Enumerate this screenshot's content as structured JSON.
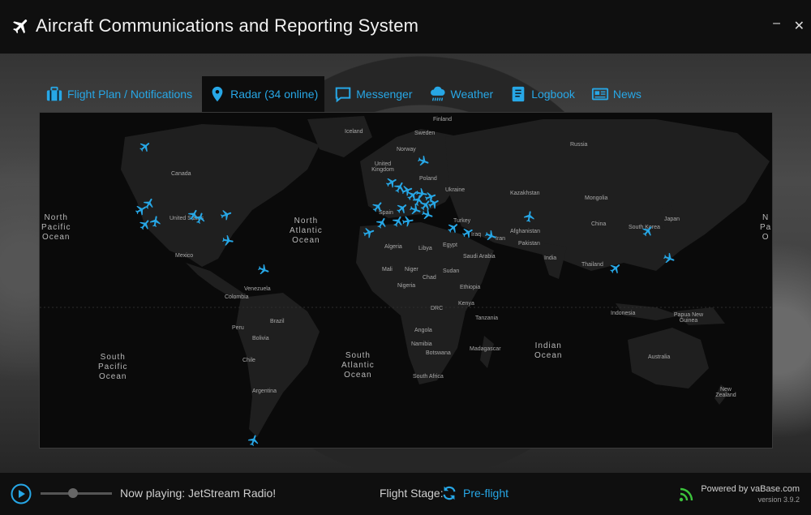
{
  "app": {
    "title": "Aircraft Communications and Reporting System",
    "window_controls": [
      "minimize",
      "close"
    ],
    "minimize_glyph": "–",
    "close_glyph": "✕"
  },
  "tabs": [
    {
      "label": "Flight Plan / Notifications",
      "icon": "briefcase-icon",
      "active": false
    },
    {
      "label": "Radar (34 online)",
      "icon": "map-pin-icon",
      "active": true
    },
    {
      "label": "Messenger",
      "icon": "chat-icon",
      "active": false
    },
    {
      "label": "Weather",
      "icon": "cloud-rain-icon",
      "active": false
    },
    {
      "label": "Logbook",
      "icon": "book-icon",
      "active": false
    },
    {
      "label": "News",
      "icon": "newspaper-icon",
      "active": false
    }
  ],
  "map": {
    "oceans": [
      "North\nPacific\nOcean",
      "North\nAtlantic\nOcean",
      "South\nPacific\nOcean",
      "South\nAtlantic\nOcean",
      "Indian\nOcean",
      "N\nPa\nO"
    ],
    "labels": [
      "Finland",
      "Iceland",
      "Sweden",
      "Norway",
      "Russia",
      "United Kingdom",
      "Poland",
      "Ukraine",
      "Kazakhstan",
      "Mongolia",
      "Canada",
      "United States",
      "Spain",
      "Turkey",
      "China",
      "South Korea",
      "Japan",
      "Afghanistan",
      "Iraq",
      "Iran",
      "Pakistan",
      "Mexico",
      "Algeria",
      "Libya",
      "Egypt",
      "Saudi Arabia",
      "India",
      "Thailand",
      "Mali",
      "Niger",
      "Sudan",
      "Chad",
      "Nigeria",
      "Ethiopia",
      "Venezuela",
      "Colombia",
      "Kenya",
      "DRC",
      "Indonesia",
      "Papua New Guinea",
      "Brazil",
      "Peru",
      "Bolivia",
      "Tanzania",
      "Angola",
      "Namibia",
      "Botswana",
      "Madagascar",
      "Australia",
      "Chile",
      "South Africa",
      "Argentina",
      "New Zealand"
    ],
    "online_count": 34,
    "accent_color": "#27a7e6"
  },
  "player": {
    "now_playing": "Now playing: JetStream Radio!",
    "volume_fraction": 0.45
  },
  "flight_stage": {
    "label": "Flight Stage:",
    "value": "Pre-flight"
  },
  "footer": {
    "powered_by": "Powered by vaBase.com",
    "version": "version 3.9.2"
  }
}
